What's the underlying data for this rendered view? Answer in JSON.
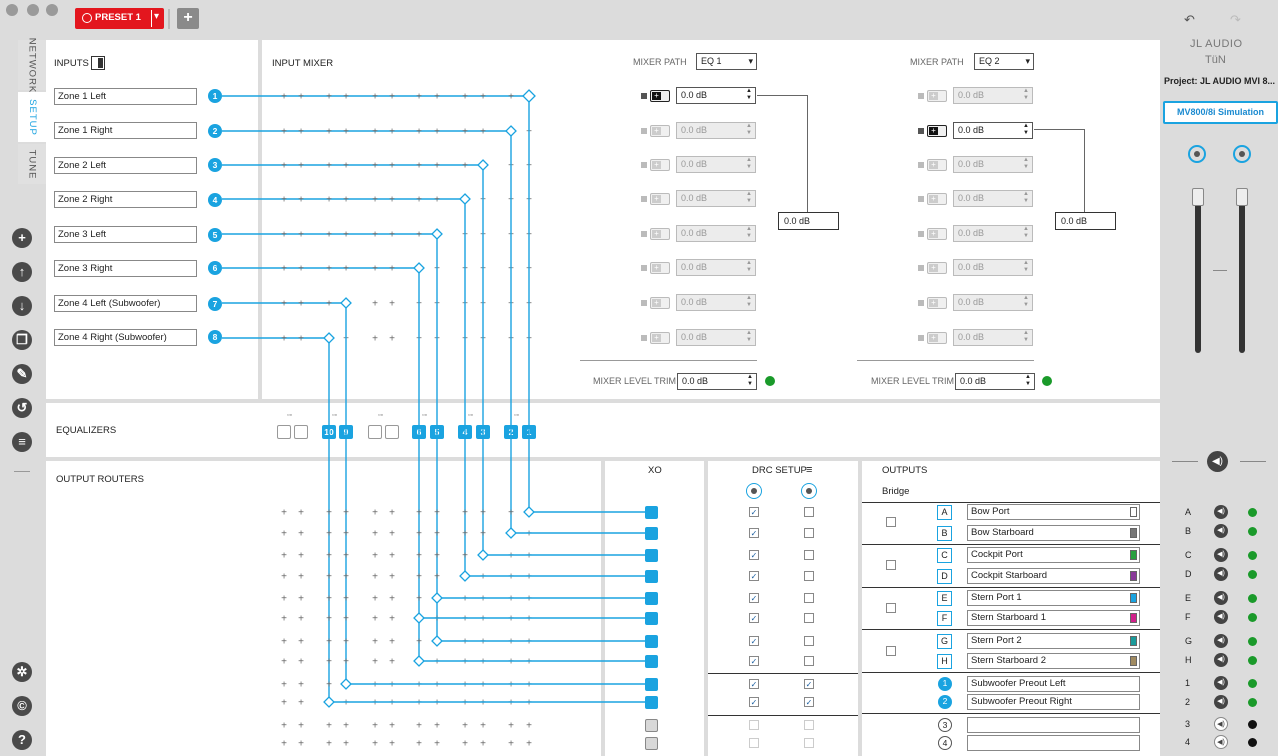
{
  "preset": {
    "label": "PRESET 1"
  },
  "side_tabs": [
    "NETWORK",
    "SETUP",
    "TUNE"
  ],
  "inputs": {
    "header": "INPUTS",
    "items": [
      {
        "num": "1",
        "name": "Zone 1 Left"
      },
      {
        "num": "2",
        "name": "Zone 1 Right"
      },
      {
        "num": "3",
        "name": "Zone 2 Left"
      },
      {
        "num": "4",
        "name": "Zone 2 Right"
      },
      {
        "num": "5",
        "name": "Zone 3 Left"
      },
      {
        "num": "6",
        "name": "Zone 3 Right"
      },
      {
        "num": "7",
        "name": "Zone 4 Left (Subwoofer)"
      },
      {
        "num": "8",
        "name": "Zone 4 Right (Subwoofer)"
      }
    ]
  },
  "input_mixer": {
    "header": "INPUT MIXER",
    "path_label": "MIXER PATH",
    "trim_label": "MIXER LEVEL TRIM",
    "paths": [
      {
        "eq": "EQ 1",
        "levels": [
          "0.0 dB",
          "0.0 dB",
          "0.0 dB",
          "0.0 dB",
          "0.0 dB",
          "0.0 dB",
          "0.0 dB",
          "0.0 dB"
        ],
        "active_row": 0,
        "sum": "0.0 dB",
        "trim": "0.0 dB"
      },
      {
        "eq": "EQ 2",
        "levels": [
          "0.0 dB",
          "0.0 dB",
          "0.0 dB",
          "0.0 dB",
          "0.0 dB",
          "0.0 dB",
          "0.0 dB",
          "0.0 dB"
        ],
        "active_row": 1,
        "sum": "0.0 dB",
        "trim": "0.0 dB"
      }
    ]
  },
  "equalizers": {
    "header": "EQUALIZERS",
    "buttons": [
      "",
      "",
      "10",
      "9",
      "",
      "",
      "6",
      "5",
      "4",
      "3",
      "2",
      "1"
    ]
  },
  "output_routers": {
    "header": "OUTPUT ROUTERS"
  },
  "xo": {
    "header": "XO"
  },
  "drc": {
    "header": "DRC SETUP",
    "checks": [
      [
        true,
        false
      ],
      [
        true,
        false
      ],
      [
        true,
        false
      ],
      [
        true,
        false
      ],
      [
        true,
        false
      ],
      [
        true,
        false
      ],
      [
        true,
        false
      ],
      [
        true,
        false
      ],
      [
        true,
        true
      ],
      [
        true,
        true
      ],
      [
        false,
        false
      ],
      [
        false,
        false
      ]
    ]
  },
  "outputs": {
    "header": "OUTPUTS",
    "bridge_label": "Bridge",
    "items": [
      {
        "id": "A",
        "name": "Bow Port",
        "color": "#ffffff"
      },
      {
        "id": "B",
        "name": "Bow Starboard",
        "color": "#777777"
      },
      {
        "id": "C",
        "name": "Cockpit Port",
        "color": "#2aa040"
      },
      {
        "id": "D",
        "name": "Cockpit Starboard",
        "color": "#8a3a9a"
      },
      {
        "id": "E",
        "name": "Stern Port 1",
        "color": "#1aa3e0"
      },
      {
        "id": "F",
        "name": "Stern Starboard 1",
        "color": "#d0208a"
      },
      {
        "id": "G",
        "name": "Stern Port 2",
        "color": "#1a9a9a"
      },
      {
        "id": "H",
        "name": "Stern Starboard 2",
        "color": "#a08a60"
      },
      {
        "id": "1",
        "name": "Subwoofer Preout Left",
        "color": ""
      },
      {
        "id": "2",
        "name": "Subwoofer Preout Right",
        "color": ""
      },
      {
        "id": "3",
        "name": "",
        "color": ""
      },
      {
        "id": "4",
        "name": "",
        "color": ""
      }
    ]
  },
  "right_panel": {
    "brand": "JL AUDIO",
    "brand2": "TüN",
    "project": "Project: JL AUDIO MVI 8...",
    "simulation": "MV800/8i Simulation",
    "channels": [
      "A",
      "B",
      "C",
      "D",
      "E",
      "F",
      "G",
      "H",
      "1",
      "2",
      "3",
      "4"
    ]
  }
}
